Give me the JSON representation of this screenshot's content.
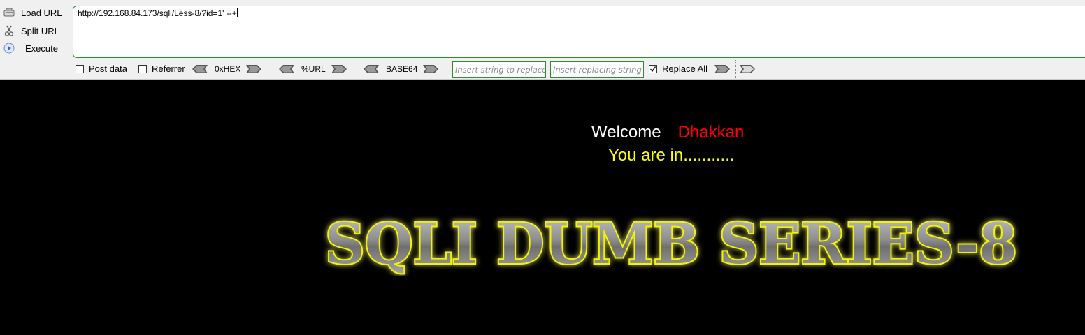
{
  "hackbar": {
    "buttons": [
      {
        "label": "Load URL",
        "icon": "load-url-icon"
      },
      {
        "label": "Split URL",
        "icon": "scissors-icon"
      },
      {
        "label": "Execute",
        "icon": "play-icon"
      }
    ],
    "url": "http://192.168.84.173/sqli/Less-8/?id=1' --+",
    "post_data_label": "Post data",
    "referrer_label": "Referrer",
    "hex_label": "0xHEX",
    "url_enc_label": "%URL",
    "base64_label": "BASE64",
    "replace_placeholder": "Insert string to replace",
    "replacing_placeholder": "Insert replacing string",
    "replace_all_label": "Replace All",
    "post_data_checked": false,
    "referrer_checked": false,
    "replace_all_checked": true
  },
  "page": {
    "welcome": "Welcome",
    "name": "Dhakkan",
    "status": "You are in...........",
    "logo_text": "SQLI DUMB SERIES-8"
  },
  "colors": {
    "accent_border": "#2e8b2e",
    "name": "#ff0000",
    "status": "#ffff00",
    "logo_glow": "#ffff00"
  }
}
